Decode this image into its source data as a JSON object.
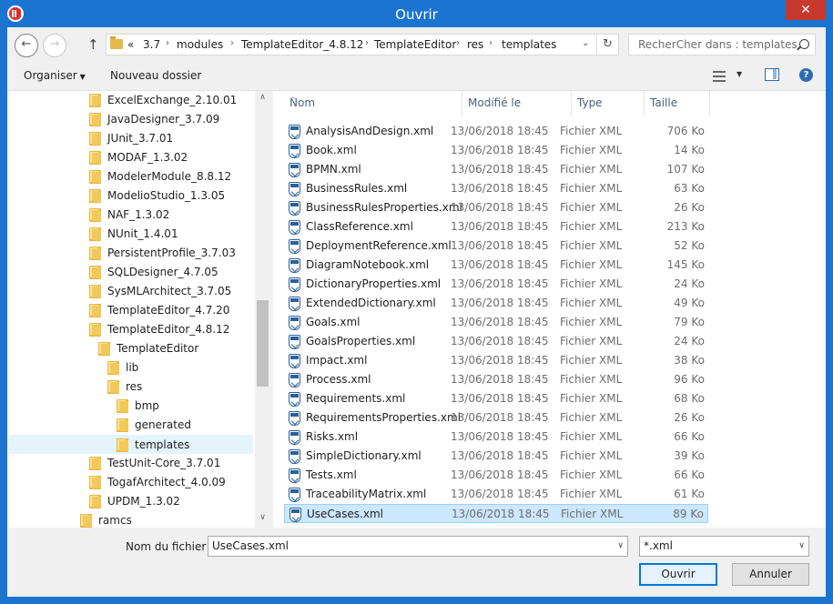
{
  "window": {
    "title": "Ouvrir",
    "close_glyph": "✕"
  },
  "nav": {
    "back_glyph": "←",
    "forward_glyph": "→",
    "up_glyph": "↑",
    "overflow": "«",
    "breadcrumbs": [
      "3.7",
      "modules",
      "TemplateEditor_4.8.12",
      "TemplateEditor",
      "res",
      "templates"
    ],
    "separator": "›",
    "chevron": "⌄",
    "refresh_glyph": "↻",
    "search_placeholder": "RecherCher dans : templates"
  },
  "toolbar": {
    "organize_label": "Organiser",
    "organize_caret": "▼",
    "new_folder_label": "Nouveau dossier",
    "view_caret": "▼",
    "help_glyph": "?"
  },
  "tree": {
    "items": [
      {
        "label": "ExcelExchange_2.10.01"
      },
      {
        "label": "JavaDesigner_3.7.09"
      },
      {
        "label": "JUnit_3.7.01"
      },
      {
        "label": "MODAF_1.3.02"
      },
      {
        "label": "ModelerModule_8.8.12"
      },
      {
        "label": "ModelioStudio_1.3.05"
      },
      {
        "label": "NAF_1.3.02"
      },
      {
        "label": "NUnit_1.4.01"
      },
      {
        "label": "PersistentProfile_3.7.03"
      },
      {
        "label": "SQLDesigner_4.7.05"
      },
      {
        "label": "SysMLArchitect_3.7.05"
      },
      {
        "label": "TemplateEditor_4.7.20"
      },
      {
        "label": "TemplateEditor_4.8.12"
      },
      {
        "label": "TemplateEditor"
      },
      {
        "label": "lib"
      },
      {
        "label": "res"
      },
      {
        "label": "bmp"
      },
      {
        "label": "generated"
      },
      {
        "label": "templates"
      },
      {
        "label": "TestUnit-Core_3.7.01"
      },
      {
        "label": "TogafArchitect_4.0.09"
      },
      {
        "label": "UPDM_1.3.02"
      },
      {
        "label": "ramcs"
      }
    ],
    "scroll_up": "∧",
    "scroll_down": "∨"
  },
  "columns": {
    "name": "Nom",
    "modified": "Modifié le",
    "type": "Type",
    "size": "Taille",
    "sort_glyph": "^"
  },
  "files": [
    {
      "name": "AnalysisAndDesign.xml",
      "date": "13/06/2018 18:45",
      "type": "Fichier XML",
      "size": "706 Ko"
    },
    {
      "name": "Book.xml",
      "date": "13/06/2018 18:45",
      "type": "Fichier XML",
      "size": "14 Ko"
    },
    {
      "name": "BPMN.xml",
      "date": "13/06/2018 18:45",
      "type": "Fichier XML",
      "size": "107 Ko"
    },
    {
      "name": "BusinessRules.xml",
      "date": "13/06/2018 18:45",
      "type": "Fichier XML",
      "size": "63 Ko"
    },
    {
      "name": "BusinessRulesProperties.xml",
      "date": "13/06/2018 18:45",
      "type": "Fichier XML",
      "size": "26 Ko"
    },
    {
      "name": "ClassReference.xml",
      "date": "13/06/2018 18:45",
      "type": "Fichier XML",
      "size": "213 Ko"
    },
    {
      "name": "DeploymentReference.xml",
      "date": "13/06/2018 18:45",
      "type": "Fichier XML",
      "size": "52 Ko"
    },
    {
      "name": "DiagramNotebook.xml",
      "date": "13/06/2018 18:45",
      "type": "Fichier XML",
      "size": "145 Ko"
    },
    {
      "name": "DictionaryProperties.xml",
      "date": "13/06/2018 18:45",
      "type": "Fichier XML",
      "size": "24 Ko"
    },
    {
      "name": "ExtendedDictionary.xml",
      "date": "13/06/2018 18:45",
      "type": "Fichier XML",
      "size": "49 Ko"
    },
    {
      "name": "Goals.xml",
      "date": "13/06/2018 18:45",
      "type": "Fichier XML",
      "size": "79 Ko"
    },
    {
      "name": "GoalsProperties.xml",
      "date": "13/06/2018 18:45",
      "type": "Fichier XML",
      "size": "24 Ko"
    },
    {
      "name": "Impact.xml",
      "date": "13/06/2018 18:45",
      "type": "Fichier XML",
      "size": "38 Ko"
    },
    {
      "name": "Process.xml",
      "date": "13/06/2018 18:45",
      "type": "Fichier XML",
      "size": "96 Ko"
    },
    {
      "name": "Requirements.xml",
      "date": "13/06/2018 18:45",
      "type": "Fichier XML",
      "size": "68 Ko"
    },
    {
      "name": "RequirementsProperties.xml",
      "date": "13/06/2018 18:45",
      "type": "Fichier XML",
      "size": "26 Ko"
    },
    {
      "name": "Risks.xml",
      "date": "13/06/2018 18:45",
      "type": "Fichier XML",
      "size": "66 Ko"
    },
    {
      "name": "SimpleDictionary.xml",
      "date": "13/06/2018 18:45",
      "type": "Fichier XML",
      "size": "39 Ko"
    },
    {
      "name": "Tests.xml",
      "date": "13/06/2018 18:45",
      "type": "Fichier XML",
      "size": "66 Ko"
    },
    {
      "name": "TraceabilityMatrix.xml",
      "date": "13/06/2018 18:45",
      "type": "Fichier XML",
      "size": "61 Ko"
    },
    {
      "name": "UseCases.xml",
      "date": "13/06/2018 18:45",
      "type": "Fichier XML",
      "size": "89 Ko"
    }
  ],
  "bottom": {
    "filename_label": "Nom du fichier :",
    "filename_value": "UseCases.xml",
    "filter_value": "*.xml",
    "dropdown_glyph": "∨",
    "open_label": "Ouvrir",
    "cancel_label": "Annuler"
  }
}
